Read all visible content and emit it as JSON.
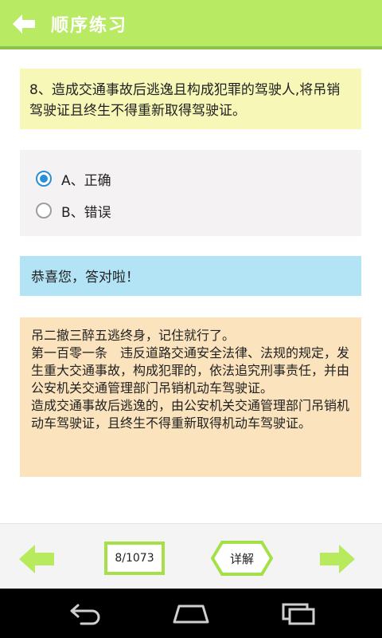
{
  "header": {
    "title": "顺序练习",
    "back_icon": "back-arrow-icon"
  },
  "question": {
    "text": "8、造成交通事故后逃逸且构成犯罪的驾驶人,将吊销驾驶证且终生不得重新取得驾驶证。"
  },
  "options": [
    {
      "label": "A、正确",
      "selected": true
    },
    {
      "label": "B、错误",
      "selected": false
    }
  ],
  "result": {
    "text": "恭喜您，答对啦！"
  },
  "explanation": {
    "lines": [
      "吊二撤三醉五逃终身，记住就行了。",
      "第一百零一条　违反道路交通安全法律、法规的规定，发生重大交通事故，构成犯罪的，依法追究刑事责任，并由公安机关交通管理部门吊销机动车驾驶证。",
      "造成交通事故后逃逸的，由公安机关交通管理部门吊销机动车驾驶证，且终生不得重新取得机动车驾驶证。"
    ]
  },
  "footer": {
    "page_indicator": "8/1073",
    "detail_label": "详解",
    "prev_icon": "arrow-left-icon",
    "next_icon": "arrow-right-icon"
  },
  "colors": {
    "header_bg": "#b9ea63",
    "accent_green": "#a6e048",
    "question_bg": "#f7f7b8",
    "result_bg": "#b2e4f6",
    "explanation_bg": "#fbe3bd",
    "radio_selected": "#2b8fd8"
  },
  "system_nav": [
    "back-nav-icon",
    "home-nav-icon",
    "recent-apps-icon"
  ]
}
